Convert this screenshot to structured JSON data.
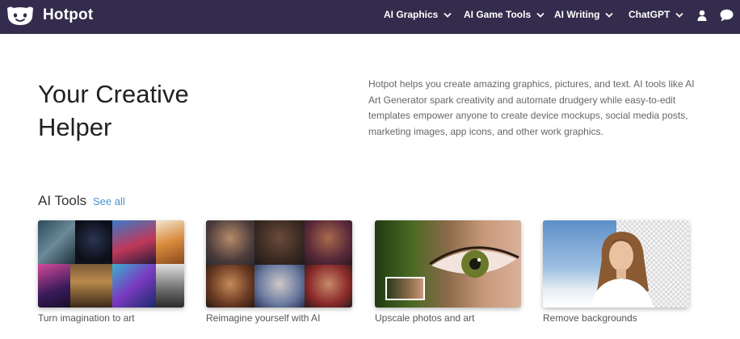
{
  "brand": {
    "name": "Hotpot"
  },
  "nav": {
    "items": [
      {
        "label": "AI Graphics"
      },
      {
        "label": "AI Game Tools"
      },
      {
        "label": "AI Writing"
      },
      {
        "label": "ChatGPT"
      }
    ],
    "icons": [
      "user-icon",
      "chat-bubble-icon"
    ]
  },
  "hero": {
    "title_line1": "Your Creative",
    "title_line2": "Helper",
    "description": "Hotpot helps you create amazing graphics, pictures, and text. AI tools like AI Art Generator spark creativity and automate drudgery while easy-to-edit templates empower anyone to create device mockups, social media posts, marketing images, app icons, and other work graphics."
  },
  "tools_section": {
    "title": "AI Tools",
    "see_all": "See all",
    "cards": [
      {
        "label": "Turn imagination to art"
      },
      {
        "label": "Reimagine yourself with AI"
      },
      {
        "label": "Upscale photos and art"
      },
      {
        "label": "Remove backgrounds"
      }
    ]
  },
  "colors": {
    "nav_bg": "#342c4c",
    "link": "#4f8fce"
  }
}
